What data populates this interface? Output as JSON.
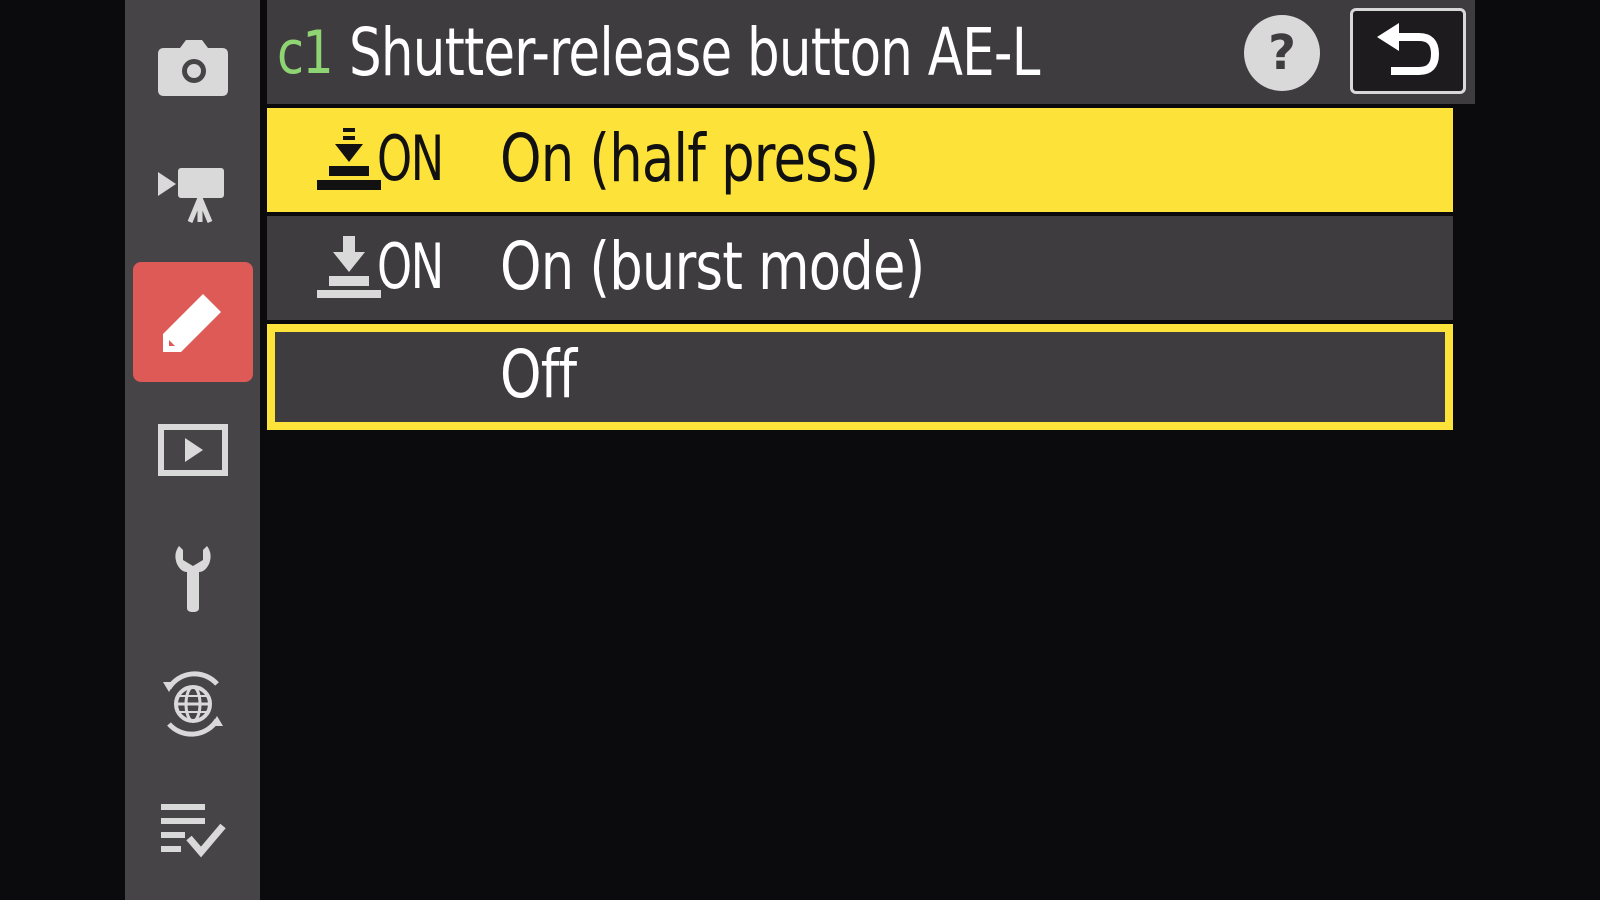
{
  "sidebar": {
    "items": [
      {
        "icon": "camera-icon",
        "name": "photo-shooting-menu",
        "active": false
      },
      {
        "icon": "movie-camera-icon",
        "name": "movie-shooting-menu",
        "active": false
      },
      {
        "icon": "pencil-icon",
        "name": "custom-settings-menu",
        "active": true
      },
      {
        "icon": "playback-icon",
        "name": "playback-menu",
        "active": false
      },
      {
        "icon": "wrench-icon",
        "name": "setup-menu",
        "active": false
      },
      {
        "icon": "network-icon",
        "name": "network-menu",
        "active": false
      },
      {
        "icon": "checklist-icon",
        "name": "my-menu",
        "active": false
      }
    ]
  },
  "header": {
    "code": "c1",
    "title": "Shutter-release button AE-L",
    "help_icon": "question-icon",
    "help_label": "?",
    "back_icon": "return-arrow-icon"
  },
  "options": [
    {
      "icon": "half-press-icon",
      "short": "ON",
      "label": "On (half press)",
      "highlighted": true
    },
    {
      "icon": "burst-mode-icon",
      "short": "ON",
      "label": "On (burst mode)",
      "highlighted": false
    },
    {
      "icon": "",
      "short": "",
      "label": "Off",
      "highlighted": false,
      "selected": true
    }
  ],
  "colors": {
    "highlight": "#fde23a",
    "active_tab": "#dd5a57",
    "code": "#8fd472",
    "panel": "#3f3c40",
    "sidebar": "#474448"
  }
}
